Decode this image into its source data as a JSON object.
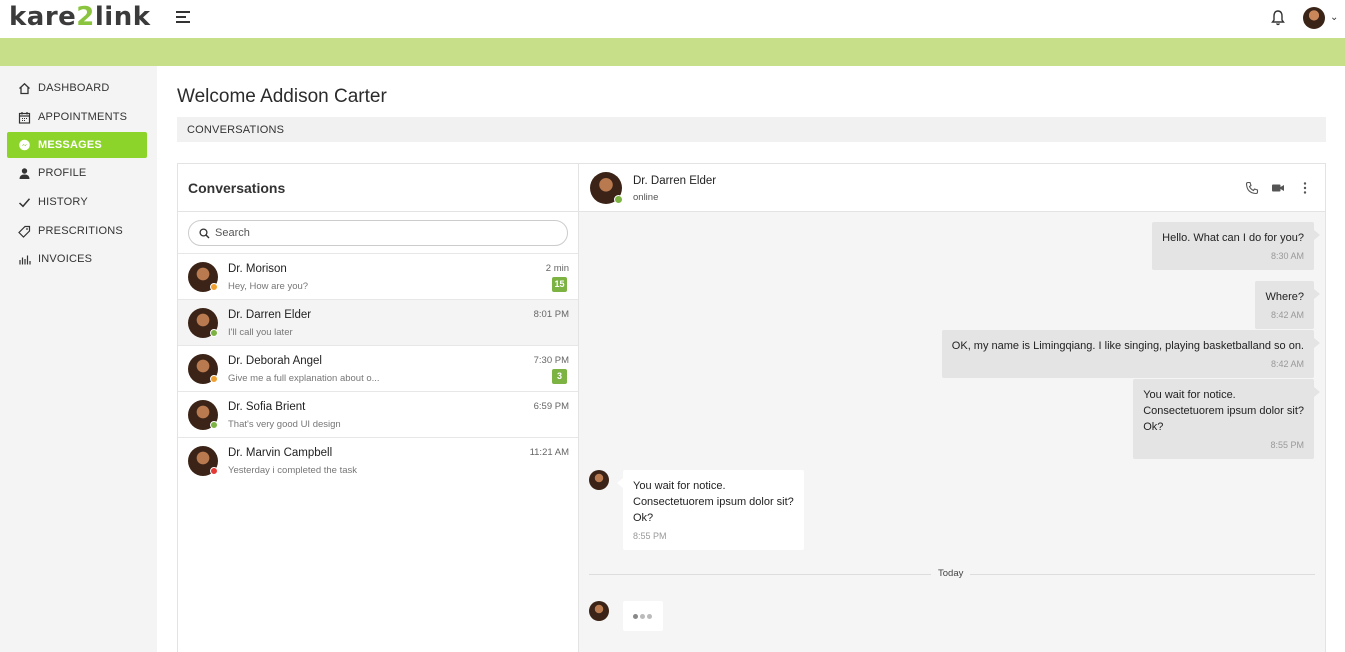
{
  "brand": {
    "logo_pre": "kare",
    "logo_two": "2",
    "logo_post": "link"
  },
  "colors": {
    "accent": "#8cd42a",
    "band": "#c6df88",
    "badge": "#7cb342",
    "online": "#7cb342",
    "away": "#f0a030",
    "busy": "#e53935"
  },
  "sidebar": {
    "items": [
      {
        "label": "DASHBOARD",
        "icon": "home-icon"
      },
      {
        "label": "APPOINTMENTS",
        "icon": "calendar-icon"
      },
      {
        "label": "MESSAGES",
        "icon": "messenger-icon",
        "active": true
      },
      {
        "label": "PROFILE",
        "icon": "user-icon"
      },
      {
        "label": "HISTORY",
        "icon": "check-icon"
      },
      {
        "label": "PRESCRITIONS",
        "icon": "tag-icon"
      },
      {
        "label": "INVOICES",
        "icon": "bar-chart-icon"
      }
    ]
  },
  "main": {
    "welcome": "Welcome Addison Carter",
    "section": "CONVERSATIONS"
  },
  "conversations": {
    "title": "Conversations",
    "search_placeholder": "Search",
    "items": [
      {
        "name": "Dr. Morison",
        "preview": "Hey, How are you?",
        "time": "2 min",
        "badge": "15",
        "status": "away"
      },
      {
        "name": "Dr. Darren Elder",
        "preview": "I'll call you later",
        "time": "8:01 PM",
        "badge": "",
        "status": "online"
      },
      {
        "name": "Dr. Deborah Angel",
        "preview": "Give me a full explanation about o...",
        "time": "7:30 PM",
        "badge": "3",
        "status": "away"
      },
      {
        "name": "Dr. Sofia Brient",
        "preview": "That's very good UI design",
        "time": "6:59 PM",
        "badge": "",
        "status": "online"
      },
      {
        "name": "Dr. Marvin Campbell",
        "preview": "Yesterday i completed the task",
        "time": "11:21 AM",
        "badge": "",
        "status": "busy"
      }
    ]
  },
  "chat": {
    "contact_name": "Dr. Darren Elder",
    "contact_status": "online",
    "messages": [
      {
        "direction": "out",
        "lines": [
          "Hello. What can I do for you?"
        ],
        "time": "8:30 AM"
      },
      {
        "direction": "out",
        "lines": [
          "Where?"
        ],
        "time": "8:42 AM"
      },
      {
        "direction": "out",
        "lines": [
          "OK, my name is Limingqiang. I like singing, playing basketballand so on."
        ],
        "time": "8:42 AM"
      },
      {
        "direction": "out",
        "lines": [
          "You wait for notice.",
          "Consectetuorem ipsum dolor sit?",
          "Ok?"
        ],
        "time": "8:55 PM"
      },
      {
        "direction": "in",
        "lines": [
          "You wait for notice.",
          "Consectetuorem ipsum dolor sit?",
          "Ok?"
        ],
        "time": "8:55 PM"
      }
    ],
    "divider_label": "Today"
  }
}
